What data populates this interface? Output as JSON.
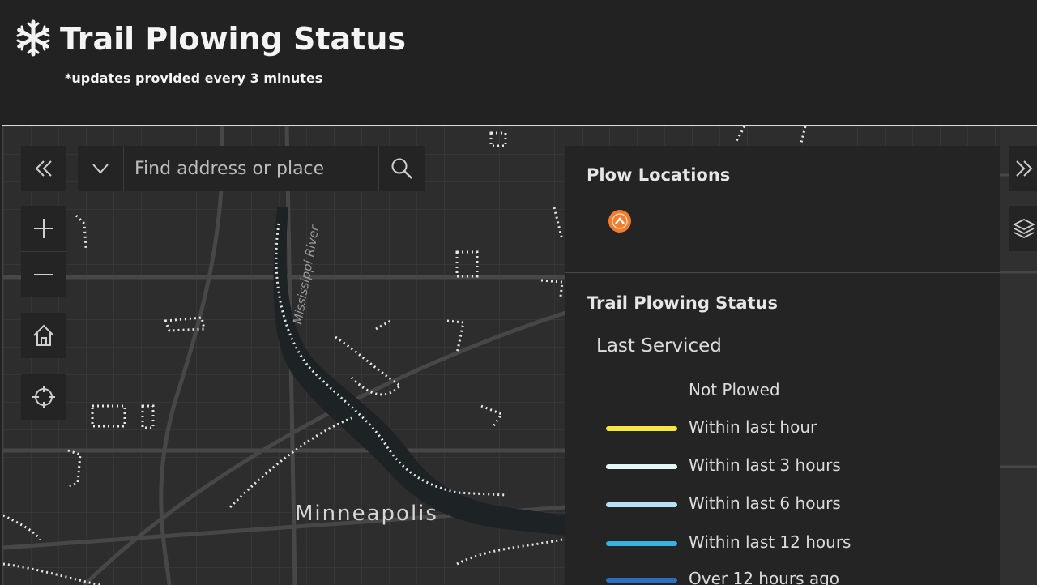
{
  "header": {
    "title": "Trail Plowing Status",
    "subtitle": "*updates provided every 3 minutes",
    "icon": "snowflake-icon"
  },
  "map": {
    "place_labels": [
      "Minneapolis",
      "Mississippi River"
    ],
    "search": {
      "placeholder": "Find address or place"
    },
    "controls": [
      "collapse-icon",
      "zoom-in-icon",
      "zoom-out-icon",
      "home-icon",
      "locate-icon"
    ],
    "right_controls": [
      "expand-icon",
      "layers-icon"
    ]
  },
  "legend": {
    "plow_title": "Plow Locations",
    "plow_symbol": {
      "icon": "chevron-up-icon",
      "color": "#f07d2e"
    },
    "status_title": "Trail Plowing Status",
    "status_subtitle": "Last Serviced",
    "items": [
      {
        "label": "Not Plowed",
        "color": "#bdbdbd",
        "style": "thin"
      },
      {
        "label": "Within last hour",
        "color": "#f5e642",
        "style": "thick"
      },
      {
        "label": "Within last 3 hours",
        "color": "#e2f7f7",
        "style": "thick"
      },
      {
        "label": "Within last 6 hours",
        "color": "#b6e3f3",
        "style": "thick"
      },
      {
        "label": "Within last 12 hours",
        "color": "#3ab0e2",
        "style": "thick"
      },
      {
        "label": "Over 12 hours ago",
        "color": "#2a6fc4",
        "style": "thick"
      }
    ]
  }
}
